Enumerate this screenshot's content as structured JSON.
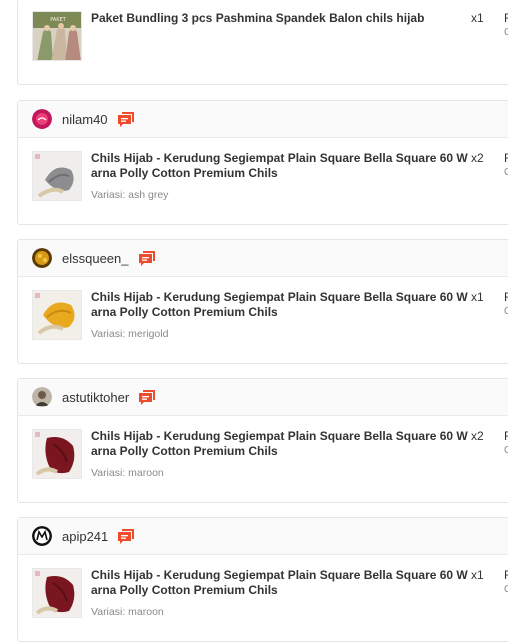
{
  "orders": [
    {
      "username": "",
      "product": "Paket Bundling 3 pcs Pashmina Spandek Balon chils hijab",
      "variation": "",
      "qty": "x1",
      "price_cut": "F",
      "price_sub": "C"
    },
    {
      "username": "nilam40",
      "product": "Chils Hijab - Kerudung Segiempat Plain Square Bella Square 60 Warna Polly Cotton Premium Chils",
      "variation": "Variasi: ash grey",
      "qty": "x2",
      "price_cut": "F",
      "price_sub": "C"
    },
    {
      "username": "elssqueen_",
      "product": "Chils Hijab - Kerudung Segiempat Plain Square Bella Square 60 Warna Polly Cotton Premium Chils",
      "variation": "Variasi: merigold",
      "qty": "x1",
      "price_cut": "F",
      "price_sub": "C"
    },
    {
      "username": "astutiktoher",
      "product": "Chils Hijab - Kerudung Segiempat Plain Square Bella Square 60 Warna Polly Cotton Premium Chils",
      "variation": "Variasi: maroon",
      "qty": "x2",
      "price_cut": "F",
      "price_sub": "C"
    },
    {
      "username": "apip241",
      "product": "Chils Hijab - Kerudung Segiempat Plain Square Bella Square 60 Warna Polly Cotton Premium Chils",
      "variation": "Variasi: maroon",
      "qty": "x1",
      "price_cut": "F",
      "price_sub": "C"
    }
  ],
  "colors": {
    "chat_icon": "#ee4d2d",
    "text": "#333333",
    "muted": "#8a8a8a"
  }
}
